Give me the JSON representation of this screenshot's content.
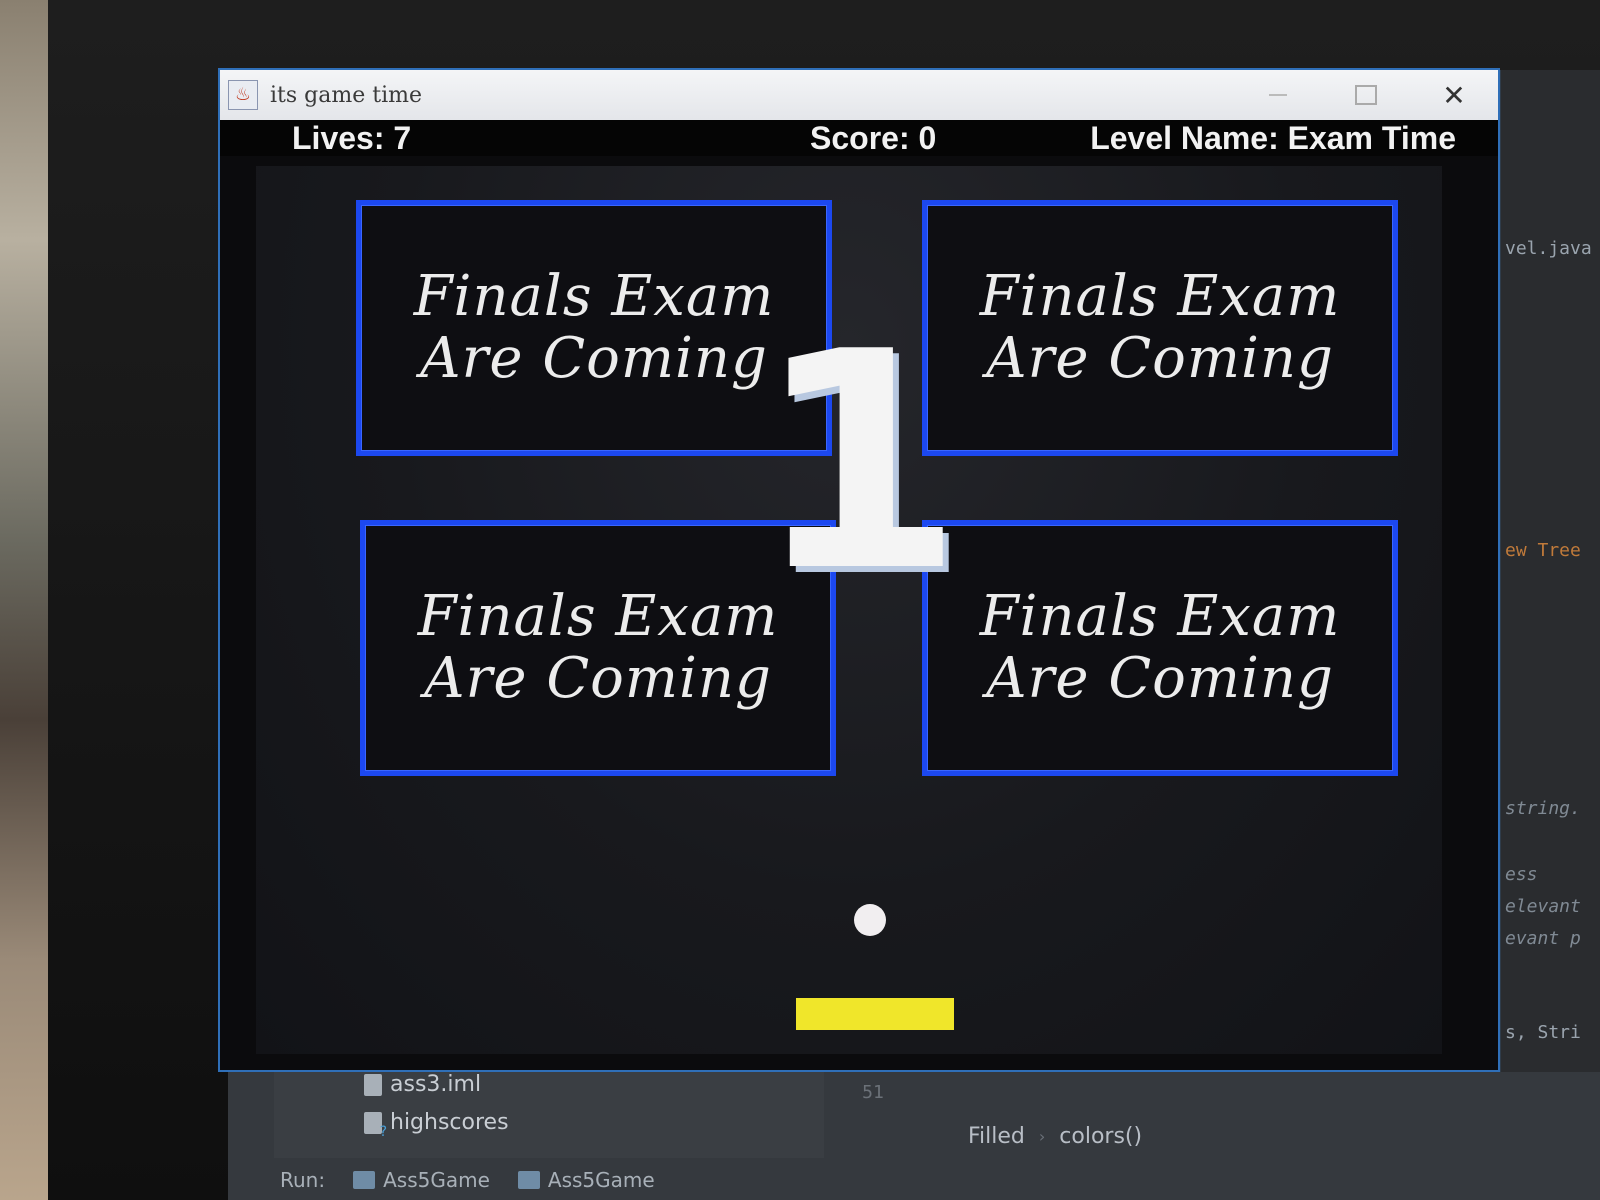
{
  "window": {
    "title": "its game time",
    "icon": "java-icon",
    "buttons": {
      "minimize": "minimize-icon",
      "maximize": "maximize-icon",
      "close": "✕"
    }
  },
  "hud": {
    "lives": "Lives: 7",
    "score": "Score: 0",
    "level": "Level Name: Exam Time"
  },
  "blocks": [
    {
      "line1": "Finals Exam",
      "line2": "Are Coming"
    },
    {
      "line1": "Finals Exam",
      "line2": "Are Coming"
    },
    {
      "line1": "Finals Exam",
      "line2": "Are Coming"
    },
    {
      "line1": "Finals Exam",
      "line2": "Are Coming"
    }
  ],
  "countdown": "1",
  "colors": {
    "block_border": "#1c48f0",
    "paddle": "#f0e62a",
    "ball": "#f1eef0"
  },
  "ide": {
    "right_snippets": [
      "vel.java",
      "ew Tree",
      "string.",
      "ess",
      "elevant",
      "evant p",
      "s, Stri"
    ],
    "project_items": [
      "ass3.iml",
      "highscores"
    ],
    "line_number": "51",
    "breadcrumb": [
      "Filled",
      "colors()"
    ],
    "run_label": "Run:",
    "run_tabs": [
      "Ass5Game",
      "Ass5Game"
    ]
  }
}
